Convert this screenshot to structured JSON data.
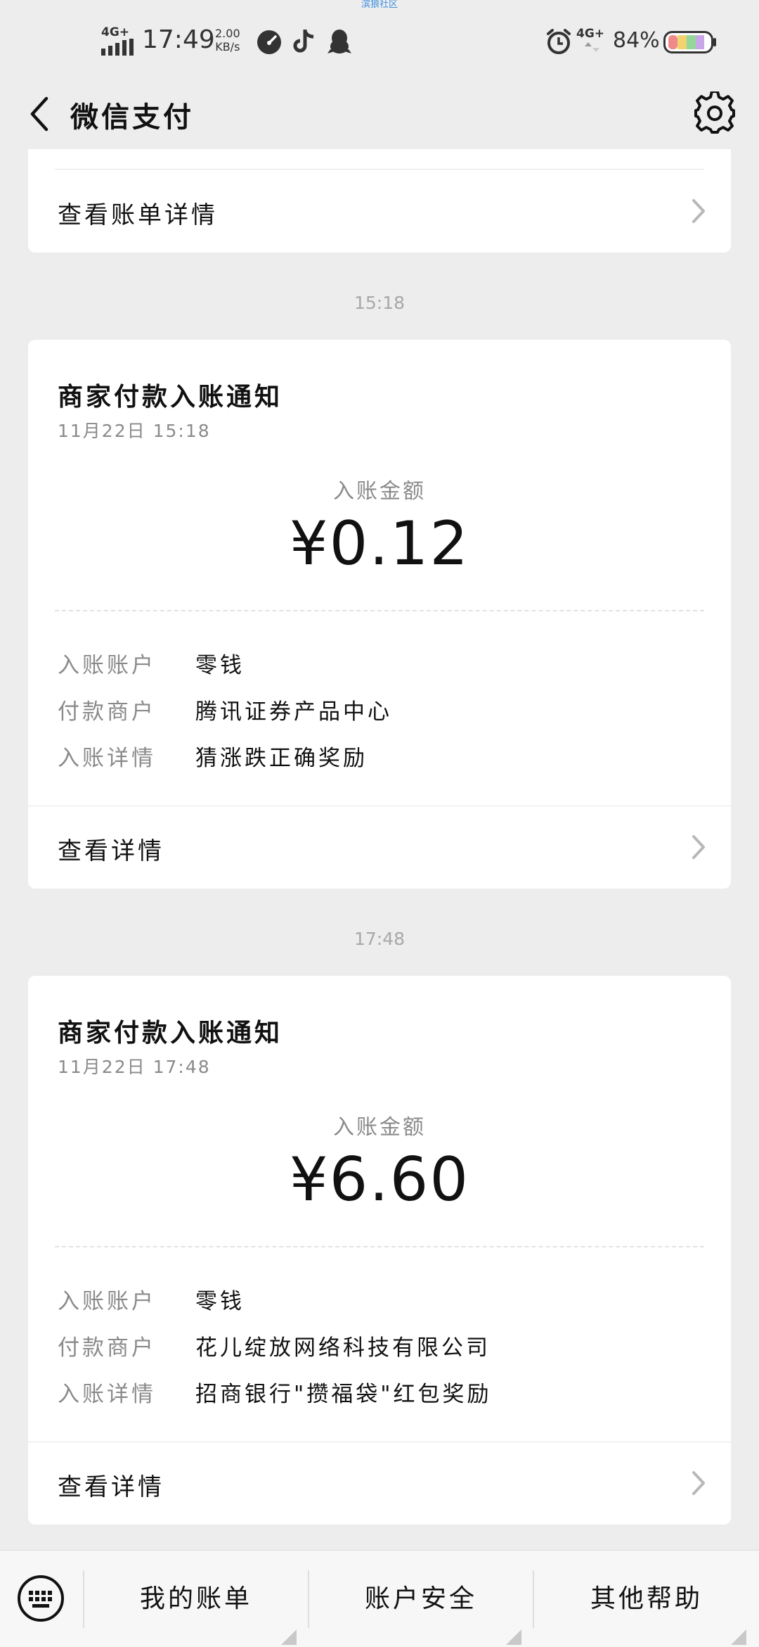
{
  "watermark": "滨狼社区",
  "status_bar": {
    "network_left": "4G+",
    "time": "17:49",
    "speed_value": "2.00",
    "speed_unit": "KB/s",
    "network_right": "4G+",
    "battery_percent": "84%",
    "icons": [
      "speedometer-icon",
      "tiktok-icon",
      "qq-penguin-icon",
      "alarm-clock-icon",
      "battery-icon"
    ]
  },
  "nav": {
    "title": "微信支付",
    "back_icon": "chevron-left-icon",
    "settings_icon": "gear-icon"
  },
  "top_card": {
    "link_label": "查看账单详情"
  },
  "messages": [
    {
      "time": "15:18",
      "title": "商家付款入账通知",
      "date_part": "11月22日",
      "time_part": "15:18",
      "amount_label": "入账金额",
      "amount": "¥0.12",
      "fields": [
        {
          "key": "入账账户",
          "value": "零钱"
        },
        {
          "key": "付款商户",
          "value": "腾讯证券产品中心"
        },
        {
          "key": "入账详情",
          "value": "猜涨跌正确奖励"
        }
      ],
      "link_label": "查看详情"
    },
    {
      "time": "17:48",
      "title": "商家付款入账通知",
      "date_part": "11月22日",
      "time_part": "17:48",
      "amount_label": "入账金额",
      "amount": "¥6.60",
      "fields": [
        {
          "key": "入账账户",
          "value": "零钱"
        },
        {
          "key": "付款商户",
          "value": "花儿绽放网络科技有限公司"
        },
        {
          "key": "入账详情",
          "value": "招商银行\"攒福袋\"红包奖励"
        }
      ],
      "link_label": "查看详情"
    }
  ],
  "bottom_bar": {
    "keyboard_icon": "keyboard-icon",
    "tabs": [
      {
        "label": "我的账单"
      },
      {
        "label": "账户安全"
      },
      {
        "label": "其他帮助"
      }
    ]
  },
  "colors": {
    "background": "#ededed",
    "card": "#ffffff",
    "muted_text": "#8a8a8a",
    "time_label": "#a8a8a8"
  }
}
